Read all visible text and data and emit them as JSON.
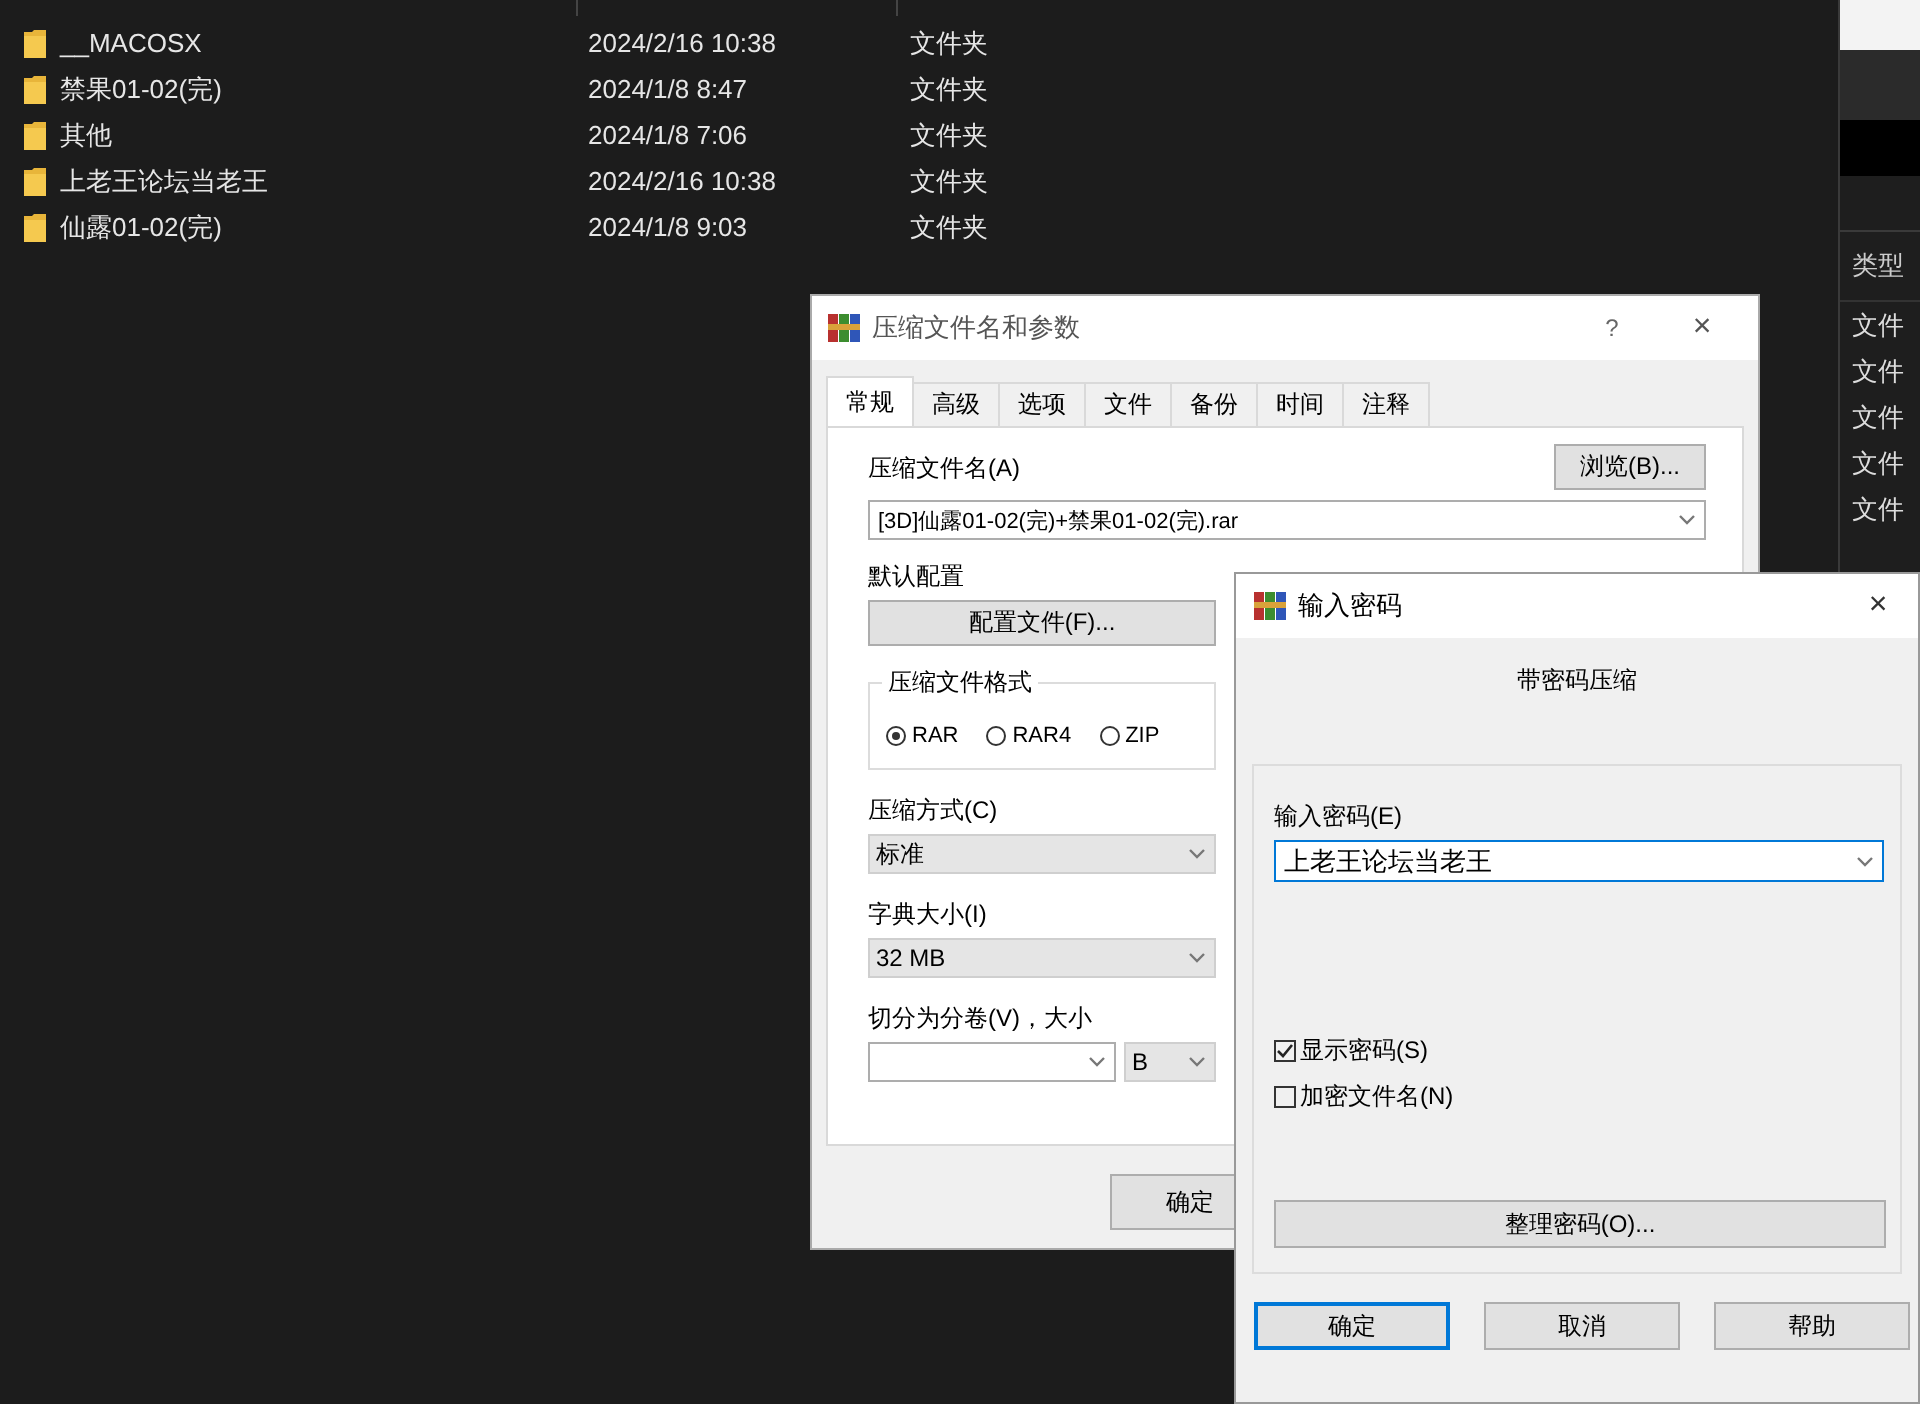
{
  "explorer": {
    "rows": [
      {
        "name": "__MACOSX",
        "modified": "2024/2/16 10:38",
        "type": "文件夹"
      },
      {
        "name": "禁果01-02(完)",
        "modified": "2024/1/8 8:47",
        "type": "文件夹"
      },
      {
        "name": "其他",
        "modified": "2024/1/8 7:06",
        "type": "文件夹"
      },
      {
        "name": "上老王论坛当老王",
        "modified": "2024/2/16 10:38",
        "type": "文件夹"
      },
      {
        "name": "仙露01-02(完)",
        "modified": "2024/1/8 9:03",
        "type": "文件夹"
      }
    ]
  },
  "side_window": {
    "column_header": "类型",
    "rows": [
      "文件",
      "文件",
      "文件",
      "文件",
      "文件"
    ]
  },
  "archive_dialog": {
    "title": "压缩文件名和参数",
    "help": "?",
    "close": "×",
    "tabs": [
      {
        "label": "常规",
        "selected": true
      },
      {
        "label": "高级",
        "selected": false
      },
      {
        "label": "选项",
        "selected": false
      },
      {
        "label": "文件",
        "selected": false
      },
      {
        "label": "备份",
        "selected": false
      },
      {
        "label": "时间",
        "selected": false
      },
      {
        "label": "注释",
        "selected": false
      }
    ],
    "archive_name_label": "压缩文件名(A)",
    "browse_button": "浏览(B)...",
    "archive_name_value": "[3D]仙露01-02(完)+禁果01-02(完).rar",
    "profile_label": "默认配置",
    "profile_button": "配置文件(F)...",
    "format_group": {
      "title": "压缩文件格式",
      "options": [
        {
          "label": "RAR",
          "selected": true
        },
        {
          "label": "RAR4",
          "selected": false
        },
        {
          "label": "ZIP",
          "selected": false
        }
      ]
    },
    "method_label": "压缩方式(C)",
    "method_value": "标准",
    "dictionary_label": "字典大小(I)",
    "dictionary_value": "32 MB",
    "split_label": "切分为分卷(V)，大小",
    "split_unit": "B",
    "ok_button": "确定"
  },
  "password_dialog": {
    "title": "输入密码",
    "close": "×",
    "heading": "带密码压缩",
    "password_label": "输入密码(E)",
    "password_value": "上老王论坛当老王",
    "options": [
      {
        "label": "显示密码(S)",
        "checked": true
      },
      {
        "label": "加密文件名(N)",
        "checked": false
      }
    ],
    "organize_button": "整理密码(O)...",
    "buttons": [
      {
        "label": "确定",
        "default": true
      },
      {
        "label": "取消",
        "default": false
      },
      {
        "label": "帮助",
        "default": false
      }
    ]
  }
}
